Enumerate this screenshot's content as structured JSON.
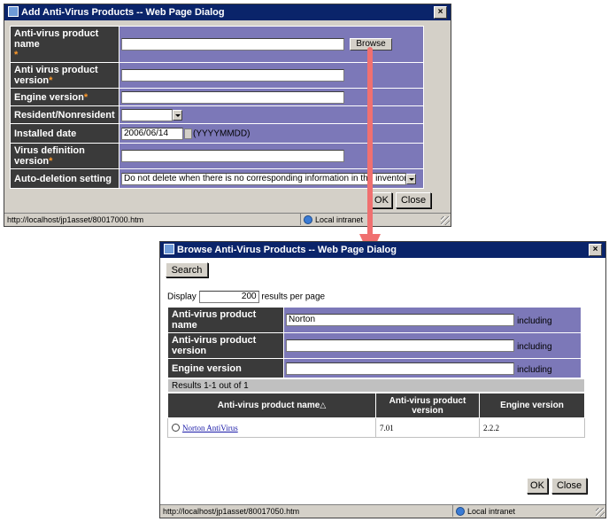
{
  "add_dialog": {
    "title": "Add Anti-Virus Products -- Web Page Dialog",
    "fields": {
      "product_name": {
        "label": "Anti-virus product name",
        "value": ""
      },
      "browse_label": "Browse",
      "product_version": {
        "label": "Anti virus product version",
        "value": ""
      },
      "engine_version": {
        "label": "Engine version",
        "value": ""
      },
      "resident": {
        "label": "Resident/Nonresident",
        "value": ""
      },
      "installed_date": {
        "label": "Installed date",
        "value": "2006/06/14",
        "hint": "(YYYYMMDD)"
      },
      "virus_def_version": {
        "label": "Virus definition version",
        "value": ""
      },
      "auto_deletion": {
        "label": "Auto-deletion setting",
        "value": "Do not delete when there is no corresponding information in the inventory"
      }
    },
    "required_mark": "*",
    "ok_label": "OK",
    "close_label": "Close",
    "status_url": "http://localhost/jp1asset/80017000.htm",
    "status_zone": "Local intranet"
  },
  "browse_dialog": {
    "title": "Browse Anti-Virus Products -- Web Page Dialog",
    "search_label": "Search",
    "display_prefix": "Display",
    "display_value": "200",
    "display_suffix": "results per page",
    "filters": [
      {
        "label": "Anti-virus product name",
        "value": "Norton",
        "qualifier": "including"
      },
      {
        "label": "Anti-virus product version",
        "value": "",
        "qualifier": "including"
      },
      {
        "label": "Engine version",
        "value": "",
        "qualifier": "including"
      }
    ],
    "results_summary": "Results 1-1 out of 1",
    "columns": [
      "Anti-virus product name",
      "Anti-virus product version",
      "Engine version"
    ],
    "sort_indicator": "△",
    "rows": [
      {
        "name": "Norton AntiVirus",
        "version": "7.01",
        "engine": "2.2.2"
      }
    ],
    "ok_label": "OK",
    "close_label": "Close",
    "status_url": "http://localhost/jp1asset/80017050.htm",
    "status_zone": "Local intranet"
  },
  "colors": {
    "label_bg": "#3a3a3a",
    "value_bg": "#7c78b8",
    "required": "#ff9a2a",
    "arrow": "#f07070",
    "title_bg": "#0a246a"
  }
}
